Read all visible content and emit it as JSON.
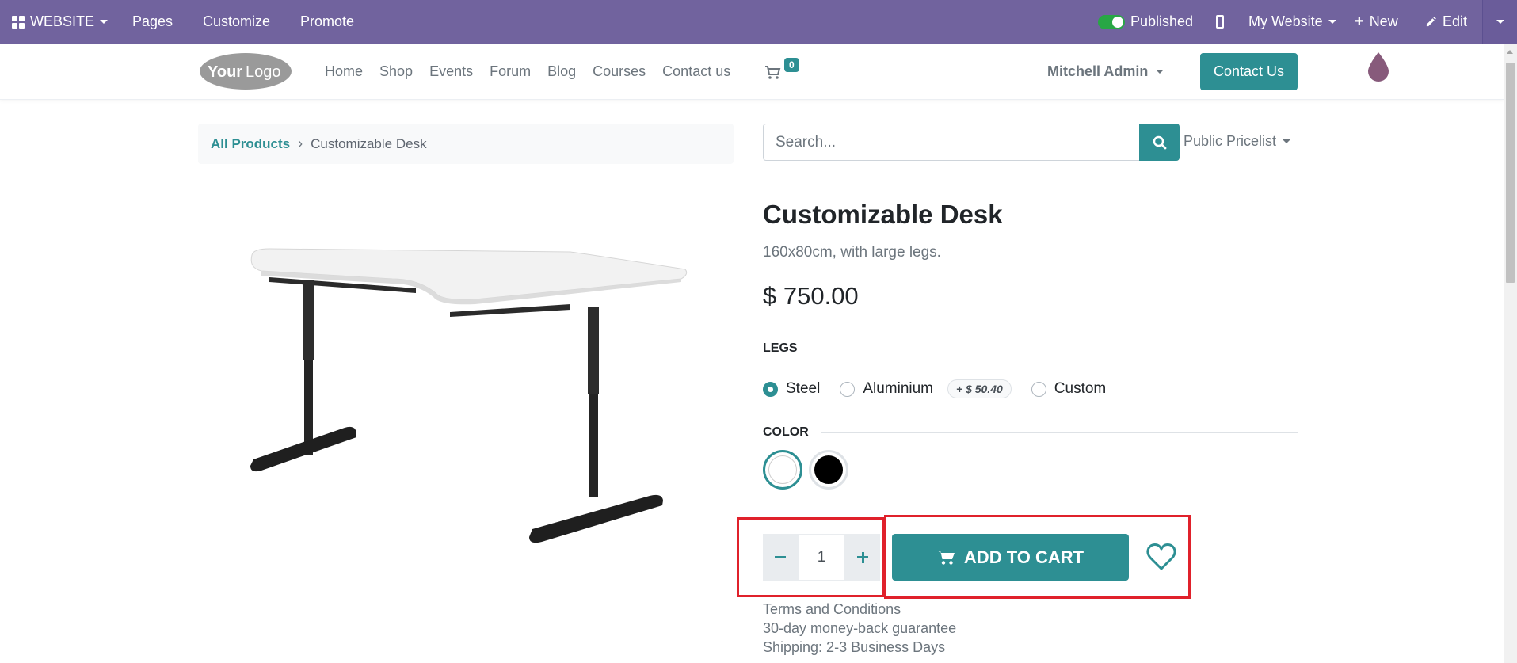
{
  "admin_bar": {
    "website_menu": "WEBSITE",
    "pages": "Pages",
    "customize": "Customize",
    "promote": "Promote",
    "published": "Published",
    "my_website": "My Website",
    "new": "New",
    "edit": "Edit"
  },
  "header": {
    "nav": [
      "Home",
      "Shop",
      "Events",
      "Forum",
      "Blog",
      "Courses",
      "Contact us"
    ],
    "cart_count": "0",
    "user": "Mitchell Admin",
    "contact_button": "Contact Us"
  },
  "breadcrumb": {
    "parent": "All Products",
    "separator": "›",
    "current": "Customizable Desk"
  },
  "search": {
    "placeholder": "Search...",
    "pricelist": "Public Pricelist"
  },
  "product": {
    "name": "Customizable Desk",
    "description": "160x80cm, with large legs.",
    "price": "$ 750.00",
    "legs_label": "LEGS",
    "legs_options": [
      "Steel",
      "Aluminium",
      "Custom"
    ],
    "legs_selected": "Steel",
    "aluminium_extra": "+ $ 50.40",
    "color_label": "COLOR",
    "colors": [
      {
        "name": "White",
        "hex": "#ffffff",
        "selected": true
      },
      {
        "name": "Black",
        "hex": "#000000",
        "selected": false
      }
    ],
    "quantity": "1",
    "add_to_cart": "ADD TO CART",
    "terms": [
      "Terms and Conditions",
      "30-day money-back guarantee",
      "Shipping: 2-3 Business Days"
    ]
  },
  "theme": {
    "admin_bar": "#71639e",
    "primary": "#2d8f93",
    "highlight": "#e0212b"
  }
}
